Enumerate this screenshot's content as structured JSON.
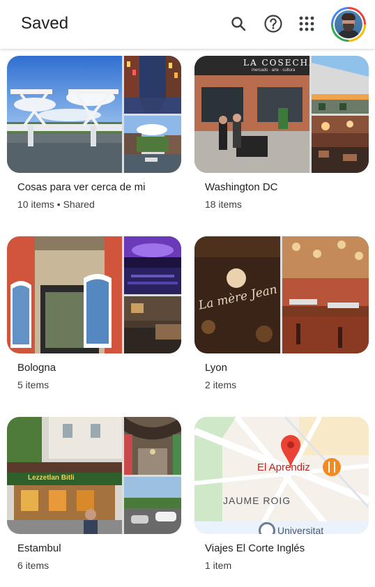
{
  "header": {
    "title": "Saved",
    "search_icon": "search-icon",
    "help_icon": "help-icon",
    "apps_icon": "apps-grid-icon",
    "avatar_icon": "account-avatar"
  },
  "lists": [
    {
      "title": "Cosas para ver cerca de mi",
      "subtitle": "10 items • Shared"
    },
    {
      "title": "Washington DC",
      "subtitle": "18 items"
    },
    {
      "title": "Bologna",
      "subtitle": "5 items"
    },
    {
      "title": "Lyon",
      "subtitle": "2 items"
    },
    {
      "title": "Estambul",
      "subtitle": "6 items"
    },
    {
      "title": "Viajes El Corte Inglés",
      "subtitle": "1 item"
    }
  ],
  "photo_text": {
    "cosecha_sign": "LA COSECHA",
    "cosecha_sub": "mercado · arte · cultura",
    "lyon_sign": "La mère Jean",
    "istanbul_sign": "Lezzetlan Bitli"
  },
  "map": {
    "place_label": "El Aprendiz",
    "district_label": "JAUME ROIG",
    "bottom_label": "Universitat",
    "accent_pin": "#ea4335",
    "accent_food": "#f28b23"
  }
}
